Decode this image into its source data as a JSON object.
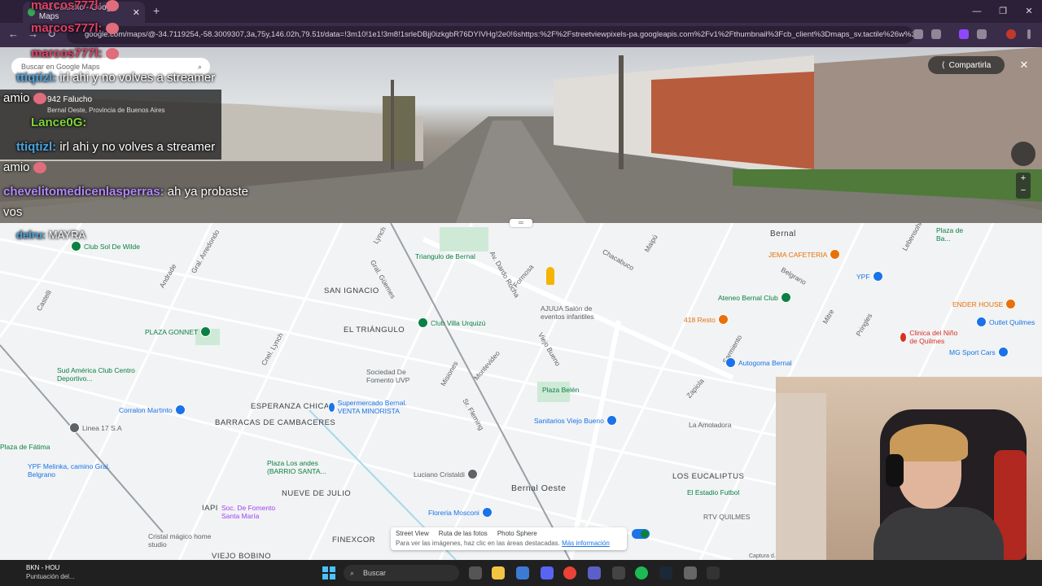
{
  "browser": {
    "tab_title": "942 Falucho - Google Maps",
    "new_tab": "+",
    "url": "google.com/maps/@-34.7119254,-58.3009307,3a,75y,146.02h,79.51t/data=!3m10!1e1!3m8!1srleDBjj0izkgbR76DYIVHg!2e0!6shttps:%2F%2Fstreetviewpixels-pa.googleapis.com%2Fv1%2Fthumbnail%3Fcb_client%3Dmaps_sv.tactile%26w%3D900...",
    "window_controls": [
      "—",
      "❐",
      "✕"
    ]
  },
  "streetview": {
    "share_label": "Compartirla",
    "close_label": "✕",
    "zoom_in": "+",
    "zoom_out": "−"
  },
  "maps_search": {
    "placeholder": "Buscar en Google Maps"
  },
  "place_card": {
    "title": "942 Falucho",
    "subtitle": "Bernal Oeste, Provincia de Buenos Aires"
  },
  "chat": [
    {
      "user": "marcos777l:",
      "message": ""
    },
    {
      "user": "marcos777l:",
      "message": ""
    },
    {
      "user": "marcos777l:",
      "message": ""
    },
    {
      "user": "ttiqtizl:",
      "message": "irl ahi y no volves a streamer"
    },
    {
      "user": "",
      "message": "amio"
    },
    {
      "user": "Lance0G:",
      "message": ""
    },
    {
      "user": "ttiqtizl:",
      "message": "irl ahi y no volves a streamer"
    },
    {
      "user": "",
      "message": "amio"
    },
    {
      "user": "chevelitomedicenlasperras:",
      "message": "ah ya probaste"
    },
    {
      "user": "",
      "message": "vos"
    },
    {
      "user": "delru:",
      "message": "MAYRA"
    }
  ],
  "map": {
    "areas": [
      "SAN IGNACIO",
      "EL TRIÁNGULO",
      "ESPERANZA CHICA",
      "BARRACAS DE CAMBACERES",
      "NUEVE DE JULIO",
      "IAPI",
      "FINEXCOR",
      "VIEJO BOBINO",
      "LOS EUCALIPTUS",
      "Bernal Oeste",
      "Bernal"
    ],
    "pois": [
      {
        "name": "Club Sol De Wilde",
        "color": "#0b8043"
      },
      {
        "name": "Triangulo de Bernal",
        "color": "#0b8043"
      },
      {
        "name": "PLAZA GONNET",
        "color": "#0b8043"
      },
      {
        "name": "Club Villa Urquizú",
        "color": "#0b8043"
      },
      {
        "name": "AJUUA Salón de eventos infantiles",
        "color": "#5f6368"
      },
      {
        "name": "Sociedad De Fomento UVP",
        "color": "#5f6368"
      },
      {
        "name": "Sud América Club Centro Deportivo...",
        "color": "#0b8043"
      },
      {
        "name": "Supermercado Bernal. VENTA MINORISTA",
        "color": "#1a73e8"
      },
      {
        "name": "Plaza Belén",
        "color": "#0b8043"
      },
      {
        "name": "Sanitarios Viejo Bueno",
        "color": "#1a73e8"
      },
      {
        "name": "Corralon Martinto",
        "color": "#1a73e8"
      },
      {
        "name": "Linea 17 S.A",
        "color": "#5f6368"
      },
      {
        "name": "Plaza Los andes (BARRIO SANTA...",
        "color": "#0b8043"
      },
      {
        "name": "Luciano Cristaldi",
        "color": "#5f6368"
      },
      {
        "name": "Floreria Mosconi",
        "color": "#1a73e8"
      },
      {
        "name": "Soc. De Fomento Santa María",
        "color": "#a142f4"
      },
      {
        "name": "Cristal mágico home studio",
        "color": "#5f6368"
      },
      {
        "name": "YPF Melinka, camino Gral. Belgrano",
        "color": "#1a73e8"
      },
      {
        "name": "JEMA CAFETERIA",
        "color": "#e8710a"
      },
      {
        "name": "Ateneo Bernal Club",
        "color": "#0b8043"
      },
      {
        "name": "418 Resto",
        "color": "#e8710a"
      },
      {
        "name": "ENDER HOUSE",
        "color": "#e8710a"
      },
      {
        "name": "Clinica del Niño de Quilmes",
        "color": "#d93025"
      },
      {
        "name": "MG Sport Cars",
        "color": "#1a73e8"
      },
      {
        "name": "Autogoma Bernal",
        "color": "#1a73e8"
      },
      {
        "name": "La Amoladora",
        "color": "#5f6368"
      },
      {
        "name": "El Estadio Futbol",
        "color": "#0b8043"
      },
      {
        "name": "RTV QUILMES",
        "color": "#5f6368"
      },
      {
        "name": "Outlet Quilmes",
        "color": "#1a73e8"
      },
      {
        "name": "YPF",
        "color": "#1a73e8"
      },
      {
        "name": "Plaza de Fátima",
        "color": "#0b8043"
      },
      {
        "name": "Plaza de Ba...",
        "color": "#0b8043"
      }
    ],
    "streets": [
      "Av. Dardo Rocha",
      "Gral. Arredondo",
      "Montevideo",
      "Formosa",
      "Zapiola",
      "Lynch",
      "Cnel. Lynch",
      "Misiones",
      "Lebensohn",
      "Belgrano",
      "Maipú",
      "Chacabuco",
      "Sarmiento",
      "Sr. Fleming",
      "Viejo Bueno",
      "Gral. Güemes",
      "Andrade",
      "Castelli",
      "Mitre",
      "Pringles"
    ],
    "legend": {
      "street_view": "Street View",
      "ruta": "Ruta de las fotos",
      "photo_sphere": "Photo Sphere",
      "hint": "Para ver las imágenes, haz clic en las áreas destacadas.",
      "more_info": "Más información"
    },
    "copyright": "Captura d..."
  },
  "taskbar": {
    "weather_title": "BKN - HOU",
    "weather_sub": "Puntuación del...",
    "search_placeholder": "Buscar",
    "accent": "#4cc2ff"
  }
}
